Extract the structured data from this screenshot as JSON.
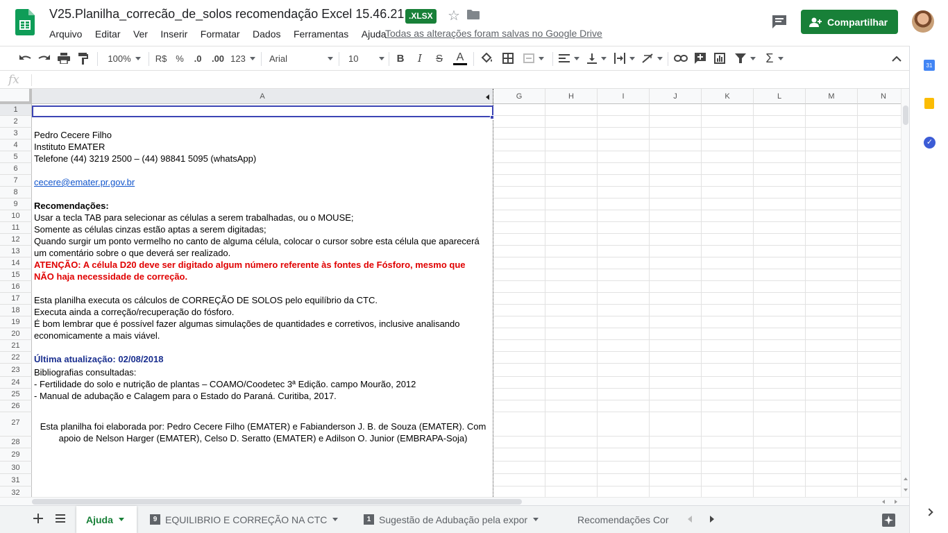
{
  "header": {
    "title": "V25.Planilha_correcão_de_solos recomendação Excel 15.46.21",
    "badge": ".XLSX",
    "menu": [
      "Arquivo",
      "Editar",
      "Ver",
      "Inserir",
      "Formatar",
      "Dados",
      "Ferramentas",
      "Ajuda"
    ],
    "saved_status": "Todas as alterações foram salvas no Google Drive",
    "share_label": "Compartilhar"
  },
  "toolbar": {
    "zoom": "100%",
    "currency": "R$",
    "percent": "%",
    "dec_decrease": ".0",
    "dec_increase": ".00",
    "more_formats": "123",
    "font": "Arial",
    "font_size": "10",
    "bold": "B",
    "italic": "I",
    "strike": "S",
    "text_color": "A",
    "sum": "Σ"
  },
  "formula_bar": {
    "fx": "fx"
  },
  "columns": [
    "A",
    "G",
    "H",
    "I",
    "J",
    "K",
    "L",
    "M",
    "N"
  ],
  "rows": [
    "1",
    "2",
    "3",
    "4",
    "5",
    "6",
    "7",
    "8",
    "9",
    "10",
    "11",
    "12",
    "13",
    "14",
    "15",
    "16",
    "17",
    "18",
    "19",
    "20",
    "21",
    "22",
    "23",
    "24",
    "25",
    "26",
    "27",
    "28",
    "29",
    "30",
    "31",
    "32"
  ],
  "cells": {
    "r3": "Pedro Cecere Filho",
    "r4": "Instituto EMATER",
    "r5": "Telefone (44) 3219 2500 – (44) 98841 5095 (whatsApp)",
    "r7": "cecere@emater.pr.gov.br",
    "r9": "Recomendações:",
    "r10": "Usar a tecla TAB para selecionar as células a serem trabalhadas, ou o MOUSE;",
    "r11": "Somente as células cinzas estão aptas a serem digitadas;",
    "r12": "Quando surgir um ponto vermelho no canto de alguma célula, colocar o cursor sobre esta célula que aparecerá",
    "r13": "um comentário sobre o que deverá ser realizado.",
    "r14": "ATENÇÃO: A célula D20 deve ser digitado algum número referente às fontes de Fósforo, mesmo que",
    "r15": "NÃO haja necessidade de correção.",
    "r17": "Esta planilha executa os cálculos de CORREÇÃO DE SOLOS pelo equilíbrio da CTC.",
    "r18": "Executa ainda a correção/recuperação do fósforo.",
    "r19": "É bom lembrar que é possível fazer algumas simulações de quantidades e corretivos, inclusive analisando",
    "r20": "economicamente a mais viável.",
    "r22": "Última atualização: 02/08/2018",
    "r23": "Bibliografias consultadas:",
    "r24": "- Fertilidade do solo e nutrição de plantas – COAMO/Coodetec 3ª Edição. campo Mourão, 2012",
    "r25": "- Manual de adubação e Calagem para o Estado do Paraná. Curitiba, 2017.",
    "r27a": "Esta planilha foi elaborada por: Pedro Cecere Filho (EMATER) e Fabianderson J. B. de Souza (EMATER). Com",
    "r27b": "apoio de Nelson Harger (EMATER), Celso D. Seratto (EMATER) e  Adilson O. Junior (EMBRAPA-Soja)"
  },
  "sheets": [
    {
      "label": "Ajuda",
      "num": ""
    },
    {
      "label": "EQUILIBRIO E CORREÇÃO NA CTC",
      "num": "9"
    },
    {
      "label": "Sugestão de Adubação pela expor",
      "num": "1"
    },
    {
      "label": "Recomendações Cor",
      "num": ""
    }
  ],
  "colors": {
    "accent": "#188038",
    "alert": "#e00000",
    "title_blue": "#1a2f8f",
    "link": "#1155cc"
  }
}
